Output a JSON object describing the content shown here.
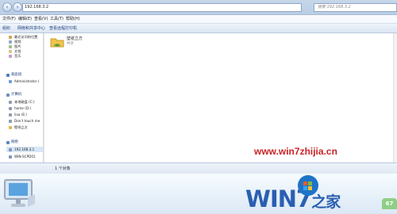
{
  "window": {
    "address": "192.168.3.2",
    "search_placeholder": "搜索 192.168.3.2"
  },
  "menu": {
    "items": [
      "文件(F)",
      "编辑(E)",
      "查看(V)",
      "工具(T)",
      "帮助(H)"
    ]
  },
  "toolbar": {
    "items": [
      "组织",
      "网络和共享中心",
      "查看远程打印机"
    ]
  },
  "sidebar": {
    "libraries": [
      "最近访问的位置",
      "视频",
      "图片",
      "文档",
      "音乐"
    ],
    "homegroup": "家庭组",
    "homegroup_user": "Administrator (",
    "computer": "计算机",
    "drives": [
      "本地磁盘 (C:)",
      "home (D:)",
      "lixa (E:)",
      "Don't touch me",
      "壁纸立方"
    ],
    "network": "网络",
    "network_items": [
      "192.168.3.1",
      "WIN-SCPD01"
    ]
  },
  "main": {
    "folder_name": "壁纸立方",
    "folder_type": "共享"
  },
  "status": {
    "item_count": "1 个对象"
  },
  "watermark": {
    "url": "www.win7zhijia.cn",
    "logo": "WIN7",
    "logo_suffix": "之家",
    "badge": "67"
  },
  "colors": {
    "accent_blue": "#2a5fb1",
    "watermark_red": "#c92226",
    "folder_yellow": "#f3c44b"
  }
}
